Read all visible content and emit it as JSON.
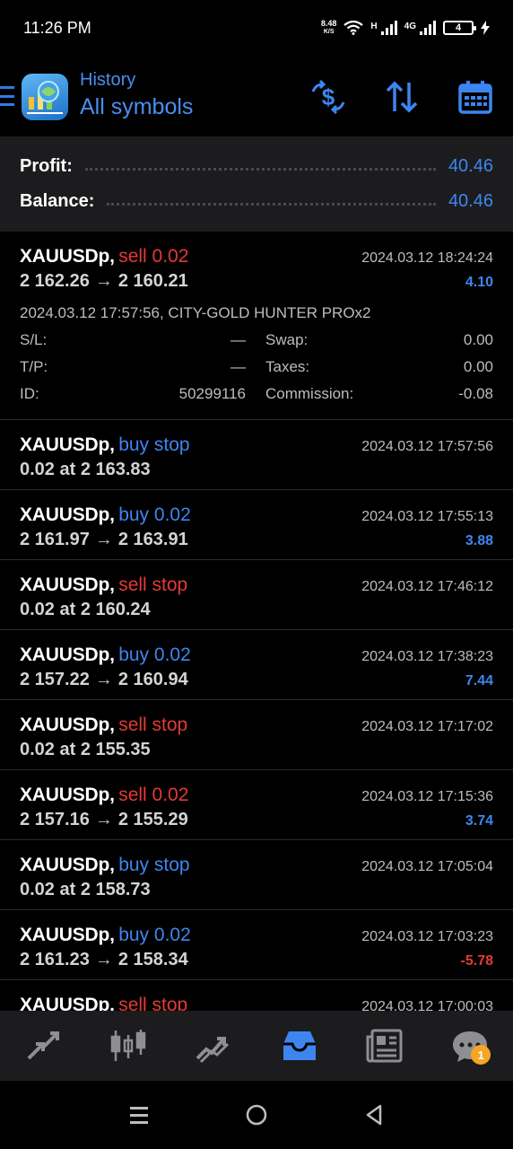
{
  "status_bar": {
    "time": "11:26 PM",
    "net_speed_value": "8.48",
    "net_speed_unit": "K/S",
    "net_h": "H",
    "net_4g": "4G",
    "battery": "4"
  },
  "header": {
    "subtitle": "History",
    "title": "All symbols"
  },
  "summary": {
    "profit_label": "Profit:",
    "profit_value": "40.46",
    "balance_label": "Balance:",
    "balance_value": "40.46"
  },
  "trades": [
    {
      "symbol": "XAUUSDp,",
      "side": "sell 0.02",
      "side_type": "sell",
      "datetime": "2024.03.12 18:24:24",
      "open": "2 162.26",
      "close": "2 160.21",
      "pnl": "4.10",
      "pnl_type": "pos",
      "details": {
        "open_info": "2024.03.12 17:57:56, CITY-GOLD HUNTER PROx2",
        "sl_label": "S/L:",
        "sl_value": "—",
        "tp_label": "T/P:",
        "tp_value": "—",
        "id_label": "ID:",
        "id_value": "50299116",
        "swap_label": "Swap:",
        "swap_value": "0.00",
        "taxes_label": "Taxes:",
        "taxes_value": "0.00",
        "commission_label": "Commission:",
        "commission_value": "-0.08"
      }
    },
    {
      "symbol": "XAUUSDp,",
      "side": "buy stop",
      "side_type": "buy",
      "datetime": "2024.03.12 17:57:56",
      "line2": "0.02 at 2 163.83"
    },
    {
      "symbol": "XAUUSDp,",
      "side": "buy 0.02",
      "side_type": "buy",
      "datetime": "2024.03.12 17:55:13",
      "open": "2 161.97",
      "close": "2 163.91",
      "pnl": "3.88",
      "pnl_type": "pos"
    },
    {
      "symbol": "XAUUSDp,",
      "side": "sell stop",
      "side_type": "sell",
      "datetime": "2024.03.12 17:46:12",
      "line2": "0.02 at 2 160.24"
    },
    {
      "symbol": "XAUUSDp,",
      "side": "buy 0.02",
      "side_type": "buy",
      "datetime": "2024.03.12 17:38:23",
      "open": "2 157.22",
      "close": "2 160.94",
      "pnl": "7.44",
      "pnl_type": "pos"
    },
    {
      "symbol": "XAUUSDp,",
      "side": "sell stop",
      "side_type": "sell",
      "datetime": "2024.03.12 17:17:02",
      "line2": "0.02 at 2 155.35"
    },
    {
      "symbol": "XAUUSDp,",
      "side": "sell 0.02",
      "side_type": "sell",
      "datetime": "2024.03.12 17:15:36",
      "open": "2 157.16",
      "close": "2 155.29",
      "pnl": "3.74",
      "pnl_type": "pos"
    },
    {
      "symbol": "XAUUSDp,",
      "side": "buy stop",
      "side_type": "buy",
      "datetime": "2024.03.12 17:05:04",
      "line2": "0.02 at 2 158.73"
    },
    {
      "symbol": "XAUUSDp,",
      "side": "buy 0.02",
      "side_type": "buy",
      "datetime": "2024.03.12 17:03:23",
      "open": "2 161.23",
      "close": "2 158.34",
      "pnl": "-5.78",
      "pnl_type": "neg"
    },
    {
      "symbol": "XAUUSDp,",
      "side": "sell stop",
      "side_type": "sell",
      "datetime": "2024.03.12 17:00:03"
    }
  ],
  "bottom_nav": {
    "items": [
      "quotes-icon",
      "chart-icon",
      "trade-icon",
      "history-icon",
      "news-icon",
      "messages-icon"
    ],
    "active": "history-icon",
    "messages_badge": "1"
  },
  "colors": {
    "accent": "#3d86f0",
    "sell": "#e53935",
    "panel": "#1c1c1e",
    "background": "#000000"
  }
}
